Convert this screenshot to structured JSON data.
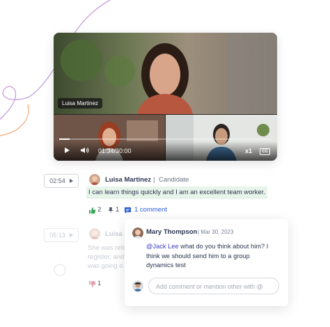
{
  "video": {
    "participant_main": "Luisa Martinez",
    "time": "01:34/30:00",
    "speed": "x1",
    "cc_label": "CC",
    "progress_fraction": 0.05
  },
  "transcript": [
    {
      "timestamp": "02:54",
      "speaker": "Luisa Martinez",
      "separator": "|",
      "role": "Candidate",
      "text": "I can learn things quickly and I am an excellent team worker.",
      "likes": "2",
      "pins": "1",
      "comments": "1 comment"
    },
    {
      "timestamp": "05:13",
      "speaker": "Luisa I",
      "text_lines": [
        "She was refe",
        "register, and",
        "was going o"
      ],
      "likes": "1"
    }
  ],
  "comment": {
    "author": "Mary Thompson",
    "date": "| Mar 30, 2023",
    "mention": "@Jack Lee",
    "body_rest": " what do you think about him? I think we should send him to a group dynamics test",
    "input_placeholder": "Add comment or mention other with @"
  },
  "colors": {
    "accent_purple": "#3a3fbf",
    "highlight_green": "#e6f4ea",
    "comment_blue": "#2a5bd7",
    "like_green": "#3aa65a",
    "dislike_pink": "#e2a3ae"
  }
}
